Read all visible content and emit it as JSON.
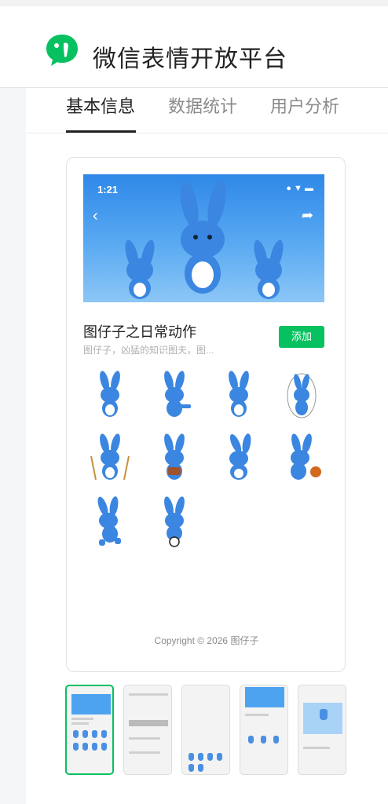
{
  "header": {
    "app_name": "微信表情开放平台",
    "logo_icon": "wechat-sticker-logo",
    "brand_color": "#07c160"
  },
  "tabs": [
    {
      "label": "基本信息",
      "active": true
    },
    {
      "label": "数据统计",
      "active": false
    },
    {
      "label": "用户分析",
      "active": false
    }
  ],
  "preview": {
    "status_time": "1:21",
    "status_icons": "● ▼ ▬",
    "pack_title": "图仔子之日常动作",
    "pack_desc": "图仔子，凶猛的知识图夫，图...",
    "add_button": "添加",
    "sticker_count": 10,
    "copyright": "Copyright © 2026 图仔子"
  },
  "thumbnails": [
    {
      "name": "thumb-preview-detail",
      "active": true
    },
    {
      "name": "thumb-chat",
      "active": false
    },
    {
      "name": "thumb-keyboard",
      "active": false
    },
    {
      "name": "thumb-banner",
      "active": false
    },
    {
      "name": "thumb-reward",
      "active": false
    }
  ],
  "colors": {
    "accent": "#07c160",
    "banner_blue": "#3d92ea",
    "bunny_blue": "#3a86e0"
  }
}
